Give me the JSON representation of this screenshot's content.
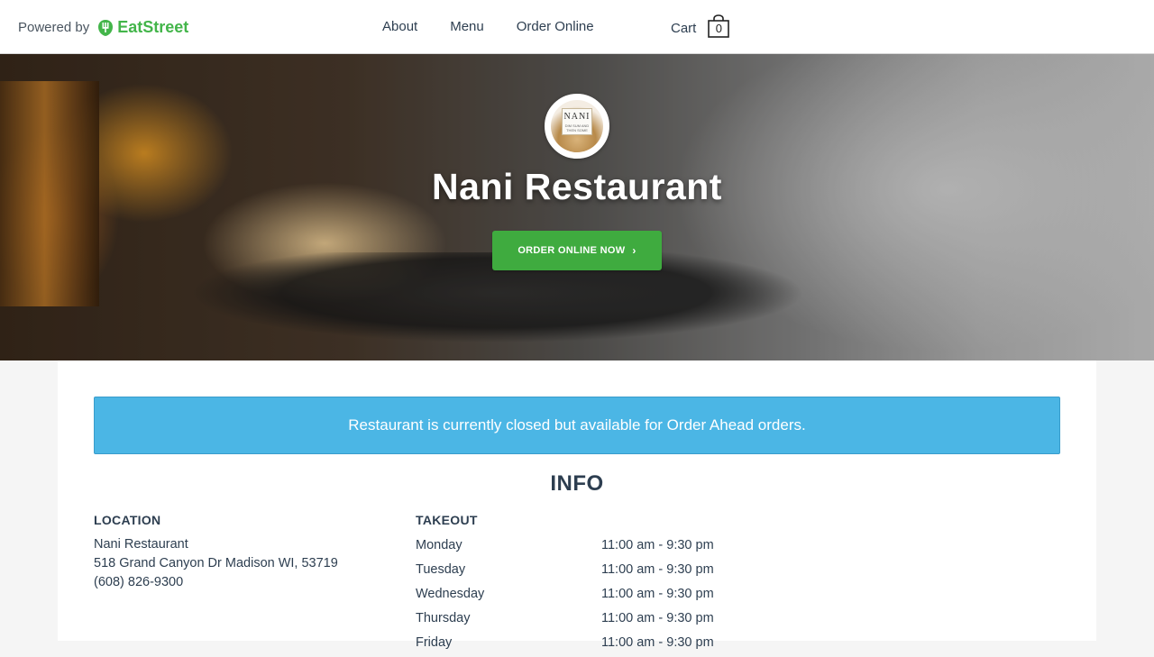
{
  "header": {
    "powered_by": "Powered by",
    "brand": "EatStreet",
    "nav": [
      "About",
      "Menu",
      "Order Online"
    ],
    "cart_label": "Cart",
    "cart_count": "0"
  },
  "hero": {
    "logo_name": "NANI",
    "logo_sub": "DIM SUM AND THEN SOME",
    "title": "Nani Restaurant",
    "order_button": "ORDER ONLINE NOW"
  },
  "alert": "Restaurant is currently closed but available for Order Ahead orders.",
  "info": {
    "title": "INFO",
    "location": {
      "heading": "LOCATION",
      "name": "Nani Restaurant",
      "address": "518 Grand Canyon Dr Madison WI, 53719",
      "phone": "(608) 826-9300"
    },
    "takeout": {
      "heading": "TAKEOUT",
      "rows": [
        {
          "day": "Monday",
          "hours": "11:00 am - 9:30 pm"
        },
        {
          "day": "Tuesday",
          "hours": "11:00 am - 9:30 pm"
        },
        {
          "day": "Wednesday",
          "hours": "11:00 am - 9:30 pm"
        },
        {
          "day": "Thursday",
          "hours": "11:00 am - 9:30 pm"
        },
        {
          "day": "Friday",
          "hours": "11:00 am - 9:30 pm"
        }
      ]
    }
  },
  "colors": {
    "brand_green": "#43b54a",
    "button_green": "#3fab3f",
    "alert_blue": "#4bb6e5",
    "text_dark": "#2d3e50"
  }
}
